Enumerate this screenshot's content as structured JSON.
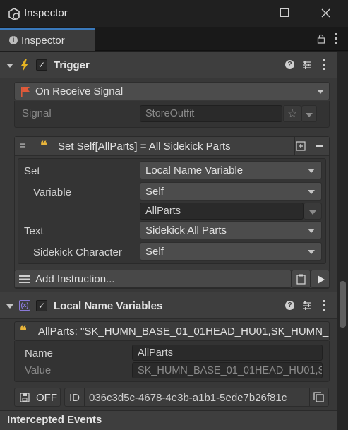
{
  "window": {
    "title": "Inspector",
    "tab_label": "Inspector"
  },
  "trigger": {
    "label": "Trigger",
    "enabled": true,
    "event_dropdown": "On Receive Signal",
    "signal_label": "Signal",
    "signal_value": "StoreOutfit"
  },
  "instruction": {
    "title": "Set Self[AllParts] = All Sidekick Parts",
    "set_label": "Set",
    "set_value": "Local Name Variable",
    "variable_label": "Variable",
    "variable_value": "Self",
    "name_value": "AllParts",
    "text_label": "Text",
    "text_value": "Sidekick All Parts",
    "character_label": "Sidekick Character",
    "character_value": "Self",
    "add_label": "Add Instruction..."
  },
  "local_vars": {
    "label": "Local Name Variables",
    "enabled": true,
    "item_text": "AllParts: \"SK_HUMN_BASE_01_01HEAD_HU01,SK_HUMN_BA",
    "name_label": "Name",
    "name_value": "AllParts",
    "value_label": "Value",
    "value_value": "SK_HUMN_BASE_01_01HEAD_HU01,S",
    "save_label": "OFF",
    "id_label": "ID",
    "id_value": "036c3d5c-4678-4e3b-a1b1-5ede7b26f81c"
  },
  "footer": {
    "label": "Intercepted Events"
  },
  "colors": {
    "accent": "#3a79bb",
    "trigger_icon": "#e6b422",
    "flag_icon": "#e05a3a",
    "vars_icon": "#8a7ad8",
    "quote_icon": "#e8b43a"
  },
  "icons": [
    "unity-logo-icon",
    "minimize-icon",
    "maximize-icon",
    "close-icon",
    "info-icon",
    "lock-icon",
    "more-icon",
    "lightning-icon",
    "flag-icon",
    "star-icon",
    "quote-icon",
    "plus-box-icon",
    "minus-icon",
    "list-icon",
    "clipboard-icon",
    "play-icon",
    "variables-icon",
    "save-icon",
    "copy-icon",
    "help-icon",
    "preset-icon"
  ]
}
